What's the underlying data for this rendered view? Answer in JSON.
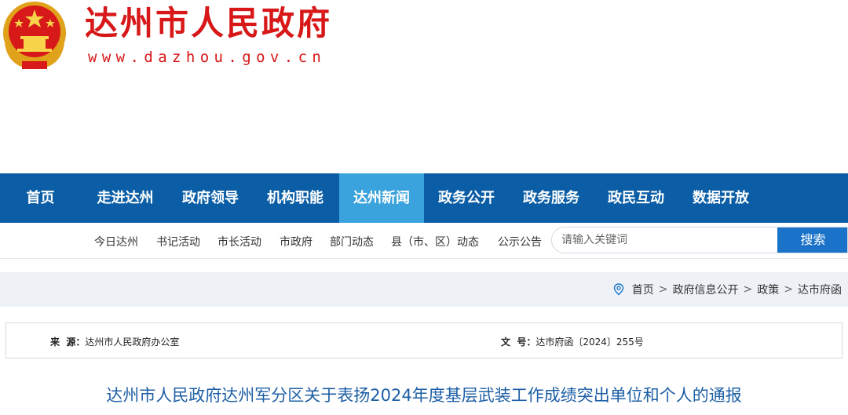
{
  "header": {
    "title": "达州市人民政府",
    "url": "www.dazhou.gov.cn",
    "emblem_icon": "national-emblem-icon"
  },
  "nav": {
    "items": [
      {
        "label": "首页"
      },
      {
        "label": "走进达州"
      },
      {
        "label": "政府领导"
      },
      {
        "label": "机构职能"
      },
      {
        "label": "达州新闻"
      },
      {
        "label": "政务公开"
      },
      {
        "label": "政务服务"
      },
      {
        "label": "政民互动"
      },
      {
        "label": "数据开放"
      }
    ],
    "active": "达州新闻"
  },
  "subnav": {
    "items": [
      "今日达州",
      "书记活动",
      "市长活动",
      "市政府",
      "部门动态",
      "县（市、区）动态",
      "公示公告"
    ]
  },
  "search": {
    "placeholder": "请输入关键词",
    "button": "搜索"
  },
  "breadcrumb": {
    "items": [
      "首页",
      "政府信息公开",
      "政策",
      "达市府函"
    ],
    "separator": ">"
  },
  "meta": {
    "source_label": "来  源：",
    "source_value": "达州市人民政府办公室",
    "doc_no_label": "文  号：",
    "doc_no_value": "达市府函〔2024〕255号"
  },
  "article": {
    "title": "达州市人民政府达州军分区关于表扬2024年度基层武装工作成绩突出单位和个人的通报"
  },
  "colors": {
    "brand_red": "#d71718",
    "nav_blue": "#0b5ea6",
    "nav_active": "#3aa2dc",
    "title_blue": "#1d5fa6"
  }
}
